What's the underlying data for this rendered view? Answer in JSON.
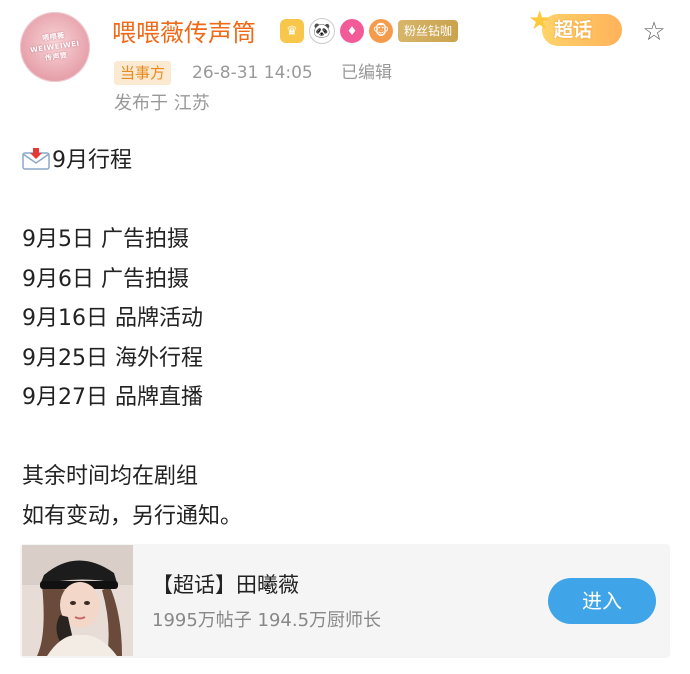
{
  "header": {
    "username": "喂喂薇传声筒",
    "fan_badge": "粉丝钻咖",
    "supertopic_label": "超话",
    "tag": "当事方",
    "time": "26-8-31 14:05",
    "edited": "已编辑",
    "location": "发布于 江苏",
    "avatar_text_1": "喂喂薇",
    "avatar_text_2": "WEIWEIWEI",
    "avatar_text_3": "传声筒"
  },
  "post": {
    "title": "9月行程",
    "schedule": [
      "9月5日 广告拍摄",
      "9月6日 广告拍摄",
      "9月16日 品牌活动",
      "9月25日 海外行程",
      "9月27日 品牌直播"
    ],
    "footer_lines": [
      "其余时间均在剧组",
      "如有变动，另行通知。"
    ]
  },
  "card": {
    "title": "【超话】田曦薇",
    "subtitle": "1995万帖子 194.5万厨师长",
    "button": "进入"
  },
  "icons": {
    "crown": "crown-icon",
    "panda": "panda-icon",
    "gem": "gem-icon",
    "monkey": "monkey-icon",
    "star": "star-outline-icon",
    "mail": "incoming-envelope-icon"
  },
  "colors": {
    "username": "#ef6a18",
    "button": "#3fa4e8",
    "tag_bg": "#fbe9d1",
    "tag_fg": "#e88a1e"
  }
}
